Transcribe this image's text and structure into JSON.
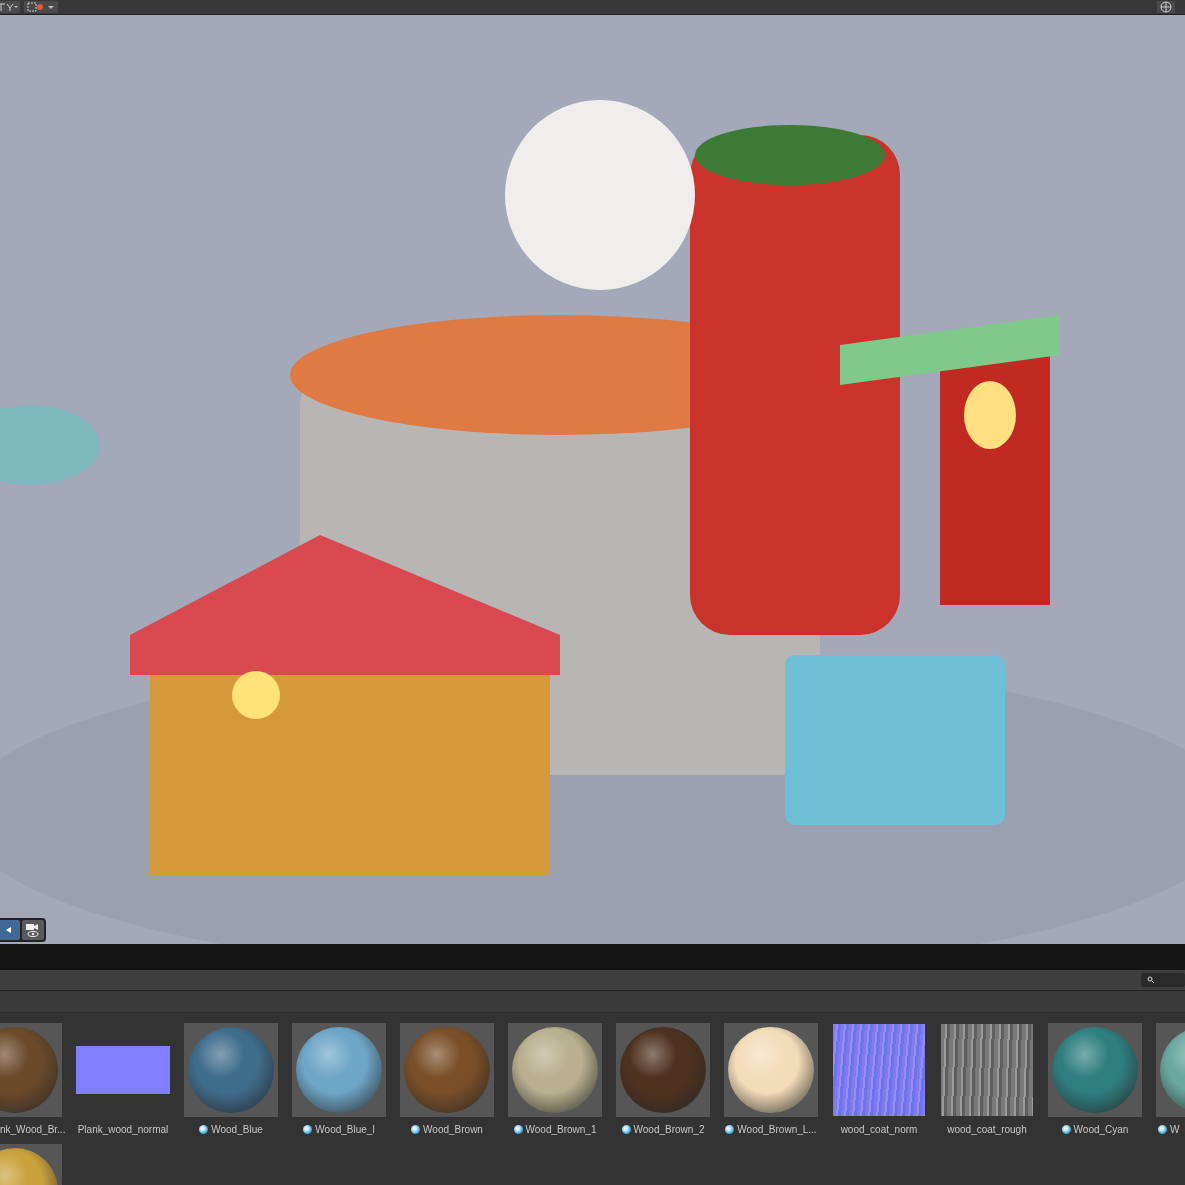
{
  "assets": [
    {
      "label": "nk_Wood_Br...",
      "kind": "sphere",
      "color": "#6b4a2a",
      "badge": false
    },
    {
      "label": "Plank_wood_normal",
      "kind": "swatch",
      "color": "#8080ff",
      "badge": false
    },
    {
      "label": "Wood_Blue",
      "kind": "sphere",
      "color": "#3f6d8c",
      "badge": true
    },
    {
      "label": "Wood_Blue_l",
      "kind": "sphere",
      "color": "#6ea6c8",
      "badge": true
    },
    {
      "label": "Wood_Brown",
      "kind": "sphere",
      "color": "#7a4f28",
      "badge": true
    },
    {
      "label": "Wood_Brown_1",
      "kind": "sphere",
      "color": "#b8b08e",
      "badge": true
    },
    {
      "label": "Wood_Brown_2",
      "kind": "sphere",
      "color": "#4e3220",
      "badge": true
    },
    {
      "label": "Wood_Brown_L...",
      "kind": "sphere",
      "color": "#f3dcb8",
      "badge": true
    },
    {
      "label": "wood_coat_norm",
      "kind": "normal-map",
      "color": "#7f7cf0",
      "badge": false
    },
    {
      "label": "wood_coat_rough",
      "kind": "grain-map",
      "color": "#7a7a7a",
      "badge": false
    },
    {
      "label": "Wood_Cyan",
      "kind": "sphere",
      "color": "#2f7f80",
      "badge": true
    },
    {
      "label": "W",
      "kind": "sphere",
      "color": "#6aa8a0",
      "badge": true
    },
    {
      "kind": "sphere",
      "color": "#c9a23c"
    }
  ]
}
